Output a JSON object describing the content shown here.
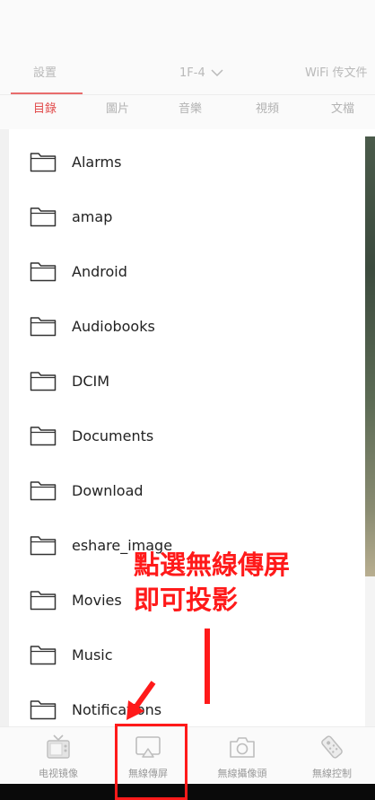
{
  "top_tabs": [
    {
      "label": "設置"
    },
    {
      "label": "1F-4"
    },
    {
      "label": "WiFi 传文件"
    }
  ],
  "sub_tabs": [
    {
      "label": "目錄",
      "active": true
    },
    {
      "label": "圖片"
    },
    {
      "label": "音樂"
    },
    {
      "label": "視頻"
    },
    {
      "label": "文檔"
    }
  ],
  "files": [
    {
      "name": "Alarms"
    },
    {
      "name": "amap"
    },
    {
      "name": "Android"
    },
    {
      "name": "Audiobooks"
    },
    {
      "name": "DCIM"
    },
    {
      "name": "Documents"
    },
    {
      "name": "Download"
    },
    {
      "name": "eshare_image"
    },
    {
      "name": "Movies"
    },
    {
      "name": "Music"
    },
    {
      "name": "Notifications"
    }
  ],
  "bottom_nav": [
    {
      "label": "电视镜像",
      "icon": "tv-icon"
    },
    {
      "label": "無線傳屏",
      "icon": "screen-cast-icon"
    },
    {
      "label": "無線攝像頭",
      "icon": "camera-icon"
    },
    {
      "label": "無線控制",
      "icon": "remote-control-icon"
    }
  ],
  "annotation": {
    "line1": "點選無線傳屏",
    "line2": "即可投影"
  },
  "colors": {
    "accent": "#e14b4b",
    "annotation": "#ff1a1a"
  }
}
